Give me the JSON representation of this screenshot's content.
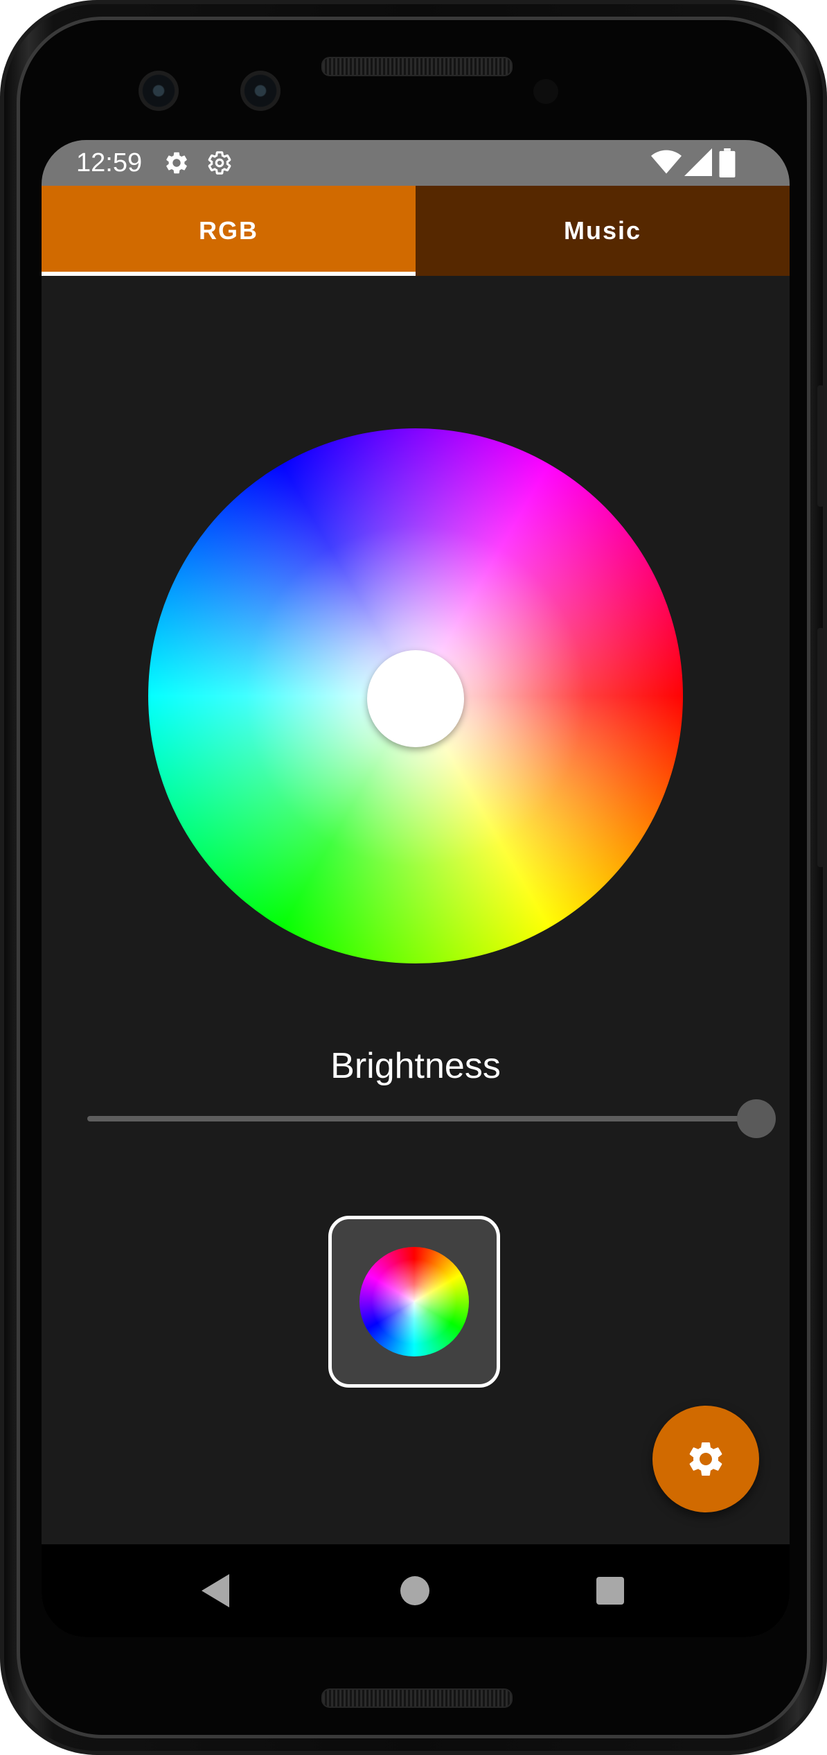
{
  "status_bar": {
    "time": "12:59",
    "left_icons": [
      "gear-icon",
      "gear-outline-icon"
    ],
    "right_icons": [
      "wifi-icon",
      "signal-icon",
      "battery-icon"
    ]
  },
  "tabs": [
    {
      "label": "RGB",
      "selected": true
    },
    {
      "label": "Music",
      "selected": false
    }
  ],
  "brightness": {
    "label": "Brightness",
    "value_fraction": 1.0
  },
  "colors": {
    "accent": "#d16a00",
    "tab_unselected": "#562800",
    "background": "#1b1b1b",
    "status_bar": "#767676"
  },
  "color_wheel": {
    "selected_color": "#ffffff"
  },
  "mode_button": {
    "icon": "color-wheel-icon"
  },
  "fab": {
    "icon": "settings-icon"
  },
  "nav_bar": {
    "buttons": [
      "back-icon",
      "home-icon",
      "recents-icon"
    ]
  }
}
